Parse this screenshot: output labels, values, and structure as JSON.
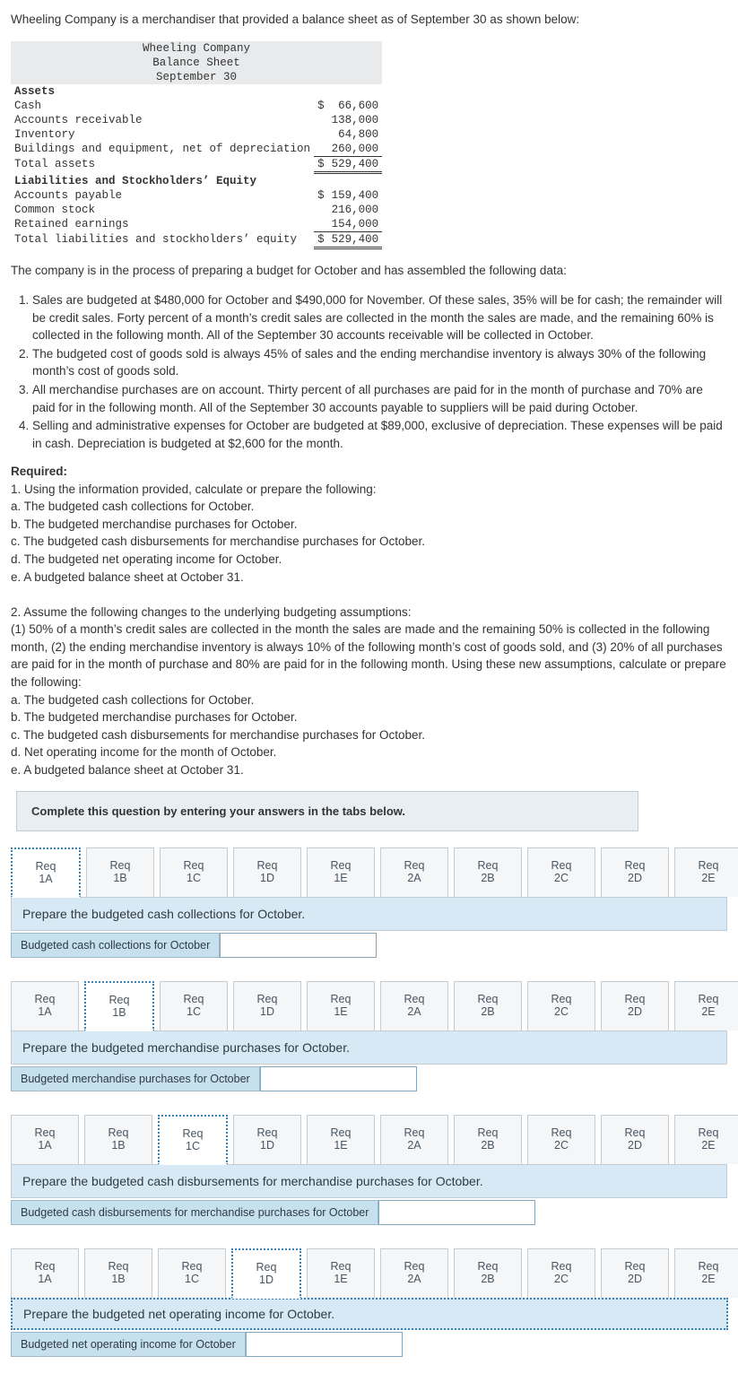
{
  "intro": "Wheeling Company is a merchandiser that provided a balance sheet as of September 30 as shown below:",
  "bs_title1": "Wheeling Company",
  "bs_title2": "Balance Sheet",
  "bs_title3": "September 30",
  "bs": {
    "h_assets": "Assets",
    "cash_l": "Cash",
    "cash_d": "$",
    "cash_v": "66,600",
    "ar_l": "Accounts receivable",
    "ar_v": "138,000",
    "inv_l": "Inventory",
    "inv_v": "64,800",
    "be_l": "Buildings and equipment, net of depreciation",
    "be_v": "260,000",
    "ta_l": "Total assets",
    "ta_d": "$",
    "ta_v": "529,400",
    "h_liab": "Liabilities and Stockholders’ Equity",
    "ap_l": "Accounts payable",
    "ap_d": "$",
    "ap_v": "159,400",
    "cs_l": "Common stock",
    "cs_v": "216,000",
    "re_l": "Retained earnings",
    "re_v": "154,000",
    "tl_l": "Total liabilities and stockholders’ equity",
    "tl_d": "$",
    "tl_v": "529,400"
  },
  "p2": "The company is in the process of preparing a budget for October and has assembled the following data:",
  "list1": [
    "Sales are budgeted at $480,000 for October and $490,000 for November. Of these sales, 35% will be for cash; the remainder will be credit sales. Forty percent of a month’s credit sales are collected in the month the sales are made, and the remaining 60% is collected in the following month. All of the September 30 accounts receivable will be collected in October.",
    "The budgeted cost of goods sold is always 45% of sales and the ending merchandise inventory is always 30% of the following month’s cost of goods sold.",
    "All merchandise purchases are on account. Thirty percent of all purchases are paid for in the month of purchase and 70% are paid for in the following month. All of the September 30 accounts payable to suppliers will be paid during October.",
    "Selling and administrative expenses for October are budgeted at $89,000, exclusive of depreciation. These expenses will be paid in cash. Depreciation is budgeted at $2,600 for the month."
  ],
  "req_h": "Required:",
  "req1": "1. Using the information provided, calculate or prepare the following:",
  "req1a": "a. The budgeted cash collections for October.",
  "req1b": "b. The budgeted merchandise purchases for October.",
  "req1c": "c. The budgeted cash disbursements for merchandise purchases for October.",
  "req1d": "d. The budgeted net operating income for October.",
  "req1e": "e. A budgeted balance sheet at October 31.",
  "req2": "2. Assume the following changes to the underlying budgeting assumptions:",
  "req2p": "(1) 50% of a month’s credit sales are collected in the month the sales are made and the remaining 50% is collected in the following month, (2) the ending merchandise inventory is always 10% of the following month’s cost of goods sold, and (3) 20% of all purchases are paid for in the month of purchase and 80% are paid for in the following month. Using these new assumptions, calculate or prepare the following:",
  "req2a": "a. The budgeted cash collections for October.",
  "req2b": "b. The budgeted merchandise purchases for October.",
  "req2c": "c. The budgeted cash disbursements for merchandise purchases for October.",
  "req2d": "d. Net operating income for the month of October.",
  "req2e": "e. A budgeted balance sheet at October 31.",
  "complete": "Complete this question by entering your answers in the tabs below.",
  "tabs": [
    "Req 1A",
    "Req 1B",
    "Req 1C",
    "Req 1D",
    "Req 1E",
    "Req 2A",
    "Req 2B",
    "Req 2C",
    "Req 2D",
    "Req 2E"
  ],
  "s1_prompt": "Prepare the budgeted cash collections for October.",
  "s1_label": "Budgeted cash collections for October",
  "s2_prompt": "Prepare the budgeted merchandise purchases for October.",
  "s2_label": "Budgeted merchandise purchases for October",
  "s3_prompt": "Prepare the budgeted cash disbursements for merchandise purchases for October.",
  "s3_label": "Budgeted cash disbursements for merchandise purchases for October",
  "s4_prompt": "Prepare the budgeted net operating income for October.",
  "s4_label": "Budgeted net operating income for October"
}
